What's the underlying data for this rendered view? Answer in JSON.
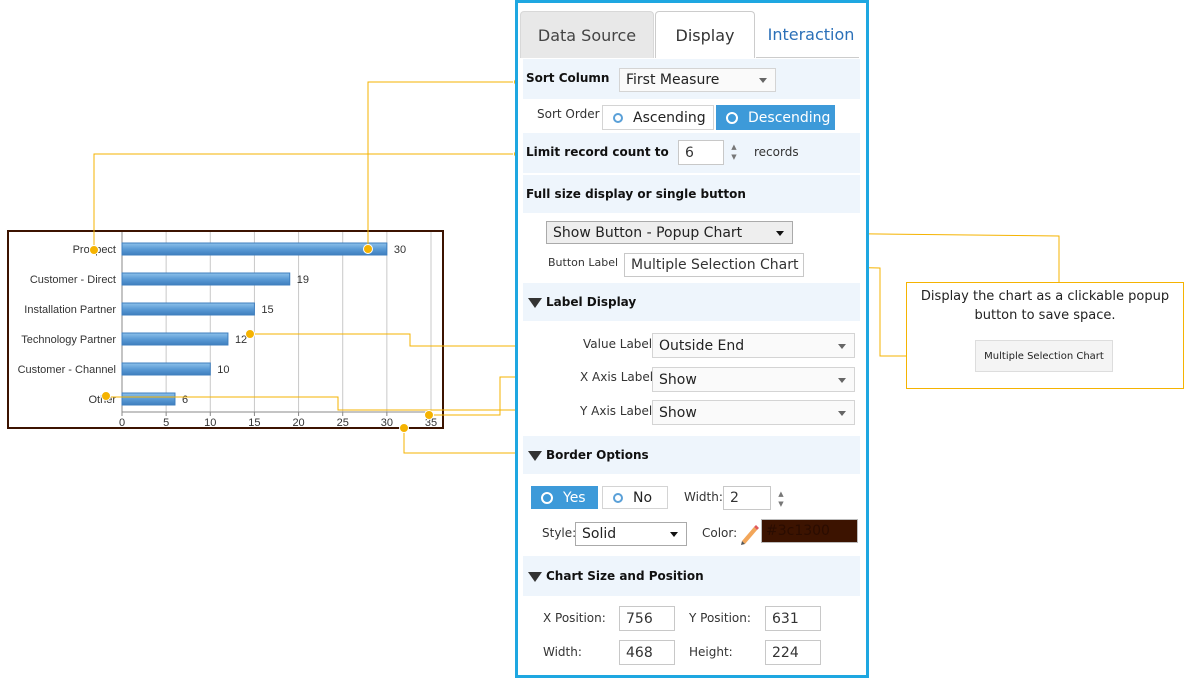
{
  "tabs": [
    {
      "label": "Data Source"
    },
    {
      "label": "Display"
    },
    {
      "label": "Interaction"
    }
  ],
  "sort": {
    "column_label": "Sort Column",
    "column_value": "First Measure",
    "order_label": "Sort Order",
    "ascending": "Ascending",
    "descending": "Descending",
    "selected": "Descending"
  },
  "limit": {
    "label": "Limit record count to",
    "value": "6",
    "unit": "records"
  },
  "full_size": {
    "heading": "Full size display or single button",
    "mode_value": "Show Button - Popup Chart",
    "button_label_label": "Button Label",
    "button_label_value": "Multiple Selection Chart"
  },
  "label_display": {
    "heading": "Label Display",
    "value_label": "Value Label",
    "value_value": "Outside End",
    "x_label": "X Axis Label",
    "x_value": "Show",
    "y_label": "Y Axis Label",
    "y_value": "Show"
  },
  "border": {
    "heading": "Border Options",
    "yes": "Yes",
    "no": "No",
    "selected": "Yes",
    "width_label": "Width:",
    "width_value": "2",
    "style_label": "Style:",
    "style_value": "Solid",
    "color_label": "Color:",
    "color_value": "#3c1300"
  },
  "size_position": {
    "heading": "Chart Size and Position",
    "x_label": "X Position:",
    "x_value": "756",
    "y_label": "Y Position:",
    "y_value": "631",
    "w_label": "Width:",
    "w_value": "468",
    "h_label": "Height:",
    "h_value": "224"
  },
  "annotation": {
    "text": "Display the chart as a clickable popup button to save space.",
    "button": "Multiple Selection Chart"
  },
  "colors": {
    "accent": "#1ea7e1",
    "callout": "#f5b301",
    "bar": "#5b9bd5",
    "chart_border": "#3c1300"
  },
  "chart_data": {
    "type": "bar",
    "orientation": "horizontal",
    "categories": [
      "Prospect",
      "Customer - Direct",
      "Installation Partner",
      "Technology Partner",
      "Customer - Channel",
      "Other"
    ],
    "values": [
      30,
      19,
      15,
      12,
      10,
      6
    ],
    "xticks": [
      "0",
      "5",
      "10",
      "15",
      "20",
      "25",
      "30",
      "35"
    ],
    "xlim": [
      0,
      35
    ],
    "grid": true,
    "value_labels": "outside-end"
  }
}
